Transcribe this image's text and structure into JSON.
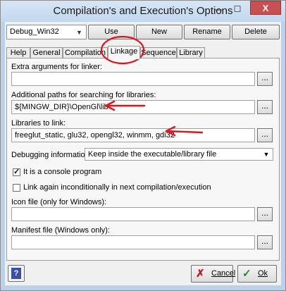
{
  "window": {
    "title": "Compilation's and Execution's Options",
    "minimize_glyph": "—",
    "maximize_glyph": "☐",
    "close_glyph": "X"
  },
  "toolbar": {
    "profile_selected": "Debug_Win32",
    "use_label": "Use",
    "new_label": "New",
    "rename_label": "Rename",
    "delete_label": "Delete"
  },
  "tabs": [
    {
      "label": "Help"
    },
    {
      "label": "General"
    },
    {
      "label": "Compilation"
    },
    {
      "label": "Linkage"
    },
    {
      "label": "Sequence"
    },
    {
      "label": "Library"
    }
  ],
  "active_tab": "Linkage",
  "linkage": {
    "extra_args_label": "Extra arguments for linker:",
    "extra_args_value": "",
    "lib_paths_label": "Additional paths for searching for libraries:",
    "lib_paths_value": "${MINGW_DIR}\\OpenGl\\lib",
    "libs_label": "Libraries to link:",
    "libs_value": "freeglut_static, glu32, opengl32, winmm, gdi32",
    "debug_info_label": "Debugging information:",
    "debug_info_value": "Keep inside the executable/library file",
    "console_label": "It is a console program",
    "console_checked": true,
    "link_again_label": "Link again inconditionally in next compilation/execution",
    "link_again_checked": false,
    "icon_label": "Icon file (only for Windows):",
    "icon_value": "",
    "manifest_label": "Manifest file (Windows only):",
    "manifest_value": "",
    "browse_label": "..."
  },
  "footer": {
    "cancel_label": "Cancel",
    "ok_label": "Ok",
    "cancel_icon_glyph": "✗",
    "ok_icon_glyph": "✓",
    "help_icon_glyph": "?"
  },
  "colors": {
    "annotation_red": "#e0141e",
    "title_bar": "#c2d7ee",
    "close_button": "#c75050"
  }
}
